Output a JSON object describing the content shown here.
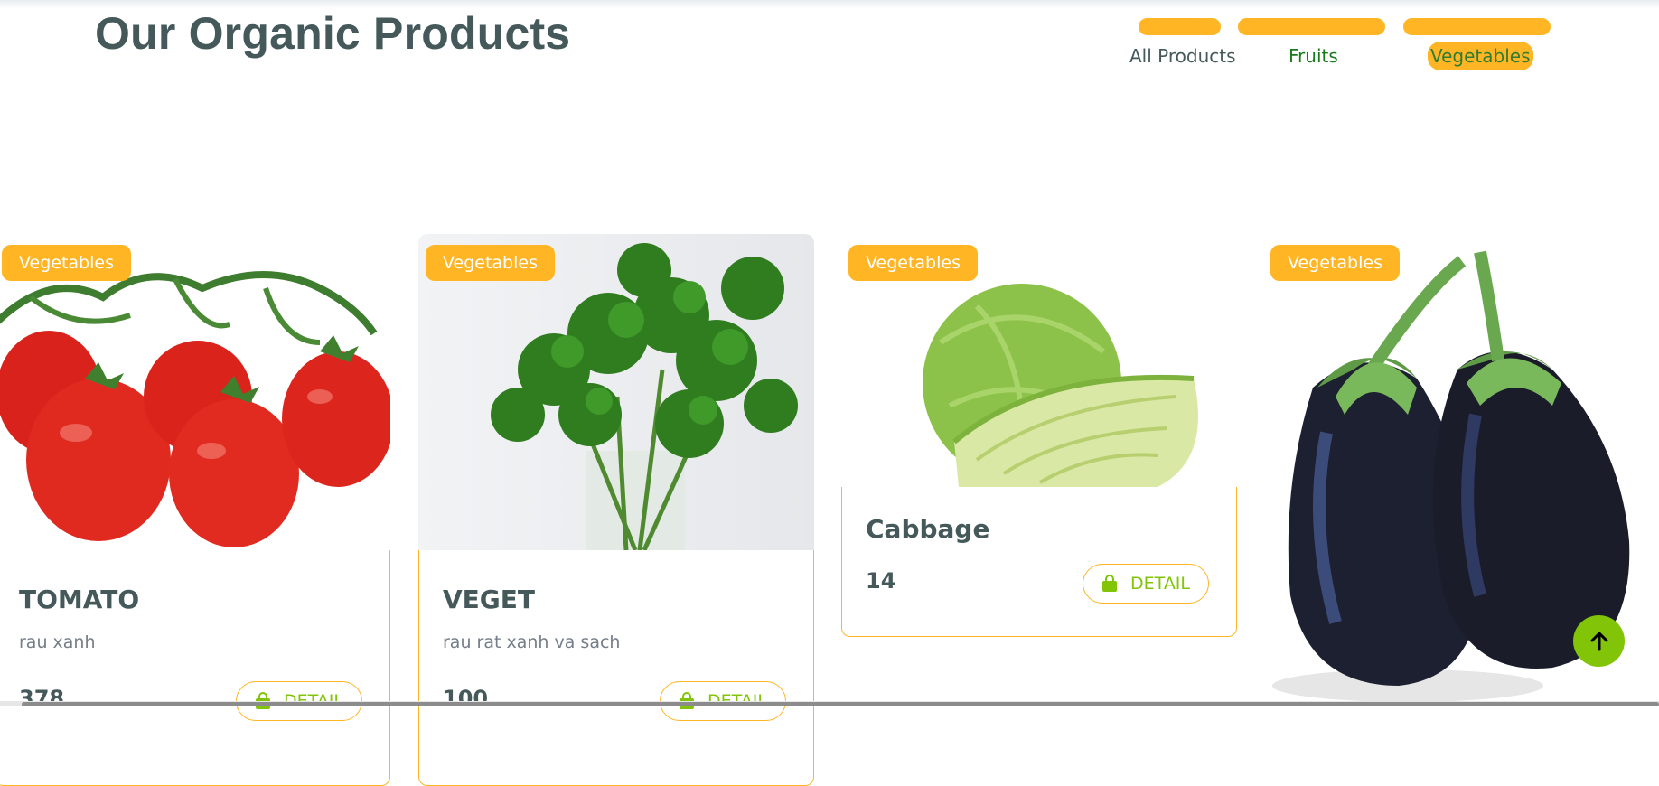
{
  "header": {
    "title": "Our Organic Products"
  },
  "tabs": [
    {
      "label": "All Products",
      "active": false
    },
    {
      "label": "Fruits",
      "active": false
    },
    {
      "label": "Vegetables",
      "active": true
    }
  ],
  "products": [
    {
      "badge": "Vegetables",
      "name": "TOMATO",
      "description": "rau xanh",
      "price": "378",
      "button": "DETAIL",
      "image": "tomato"
    },
    {
      "badge": "Vegetables",
      "name": "VEGET",
      "description": "rau rat xanh va sach",
      "price": "100",
      "button": "DETAIL",
      "image": "parsley"
    },
    {
      "badge": "Vegetables",
      "name": "Cabbage",
      "description": "",
      "price": "14",
      "button": "DETAIL",
      "image": "cabbage"
    },
    {
      "badge": "Vegetables",
      "name": "",
      "description": "",
      "price": "",
      "button": "",
      "image": "eggplant"
    }
  ],
  "icons": {
    "cart": "shopping-bag-icon",
    "back_to_top": "arrow-up-icon"
  },
  "colors": {
    "accent": "#ffb524",
    "primary_green": "#81c408",
    "text": "#45595b"
  }
}
